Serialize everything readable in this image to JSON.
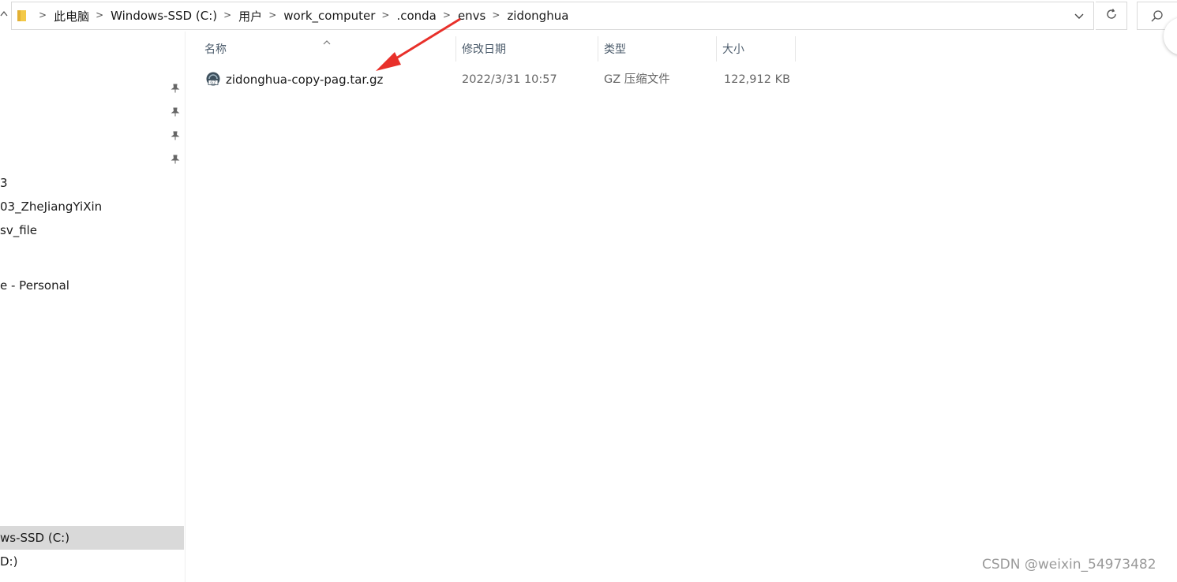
{
  "address_bar": {
    "segments": [
      "此电脑",
      "Windows-SSD (C:)",
      "用户",
      "work_computer",
      ".conda",
      "envs",
      "zidonghua"
    ],
    "separator": ">"
  },
  "columns": {
    "name": "名称",
    "modified": "修改日期",
    "type": "类型",
    "size": "大小"
  },
  "files": [
    {
      "name": "zidonghua-copy-pag.tar.gz",
      "modified": "2022/3/31 10:57",
      "type": "GZ 压缩文件",
      "size": "122,912 KB",
      "icon": "gz-archive-icon"
    }
  ],
  "nav_pane": {
    "items": [
      {
        "label": "3"
      },
      {
        "label": "03_ZheJiangYiXin"
      },
      {
        "label": "sv_file"
      },
      {
        "label": "e - Personal"
      },
      {
        "label": "ws-SSD (C:)",
        "selected": true
      },
      {
        "label": "D:)"
      }
    ]
  },
  "watermark": "CSDN @weixin_54973482",
  "colors": {
    "selection": "#d9d9d9",
    "header_text": "#4a5a6a",
    "annotation_arrow": "#e8302a",
    "folder_yellow": "#f3c948"
  }
}
